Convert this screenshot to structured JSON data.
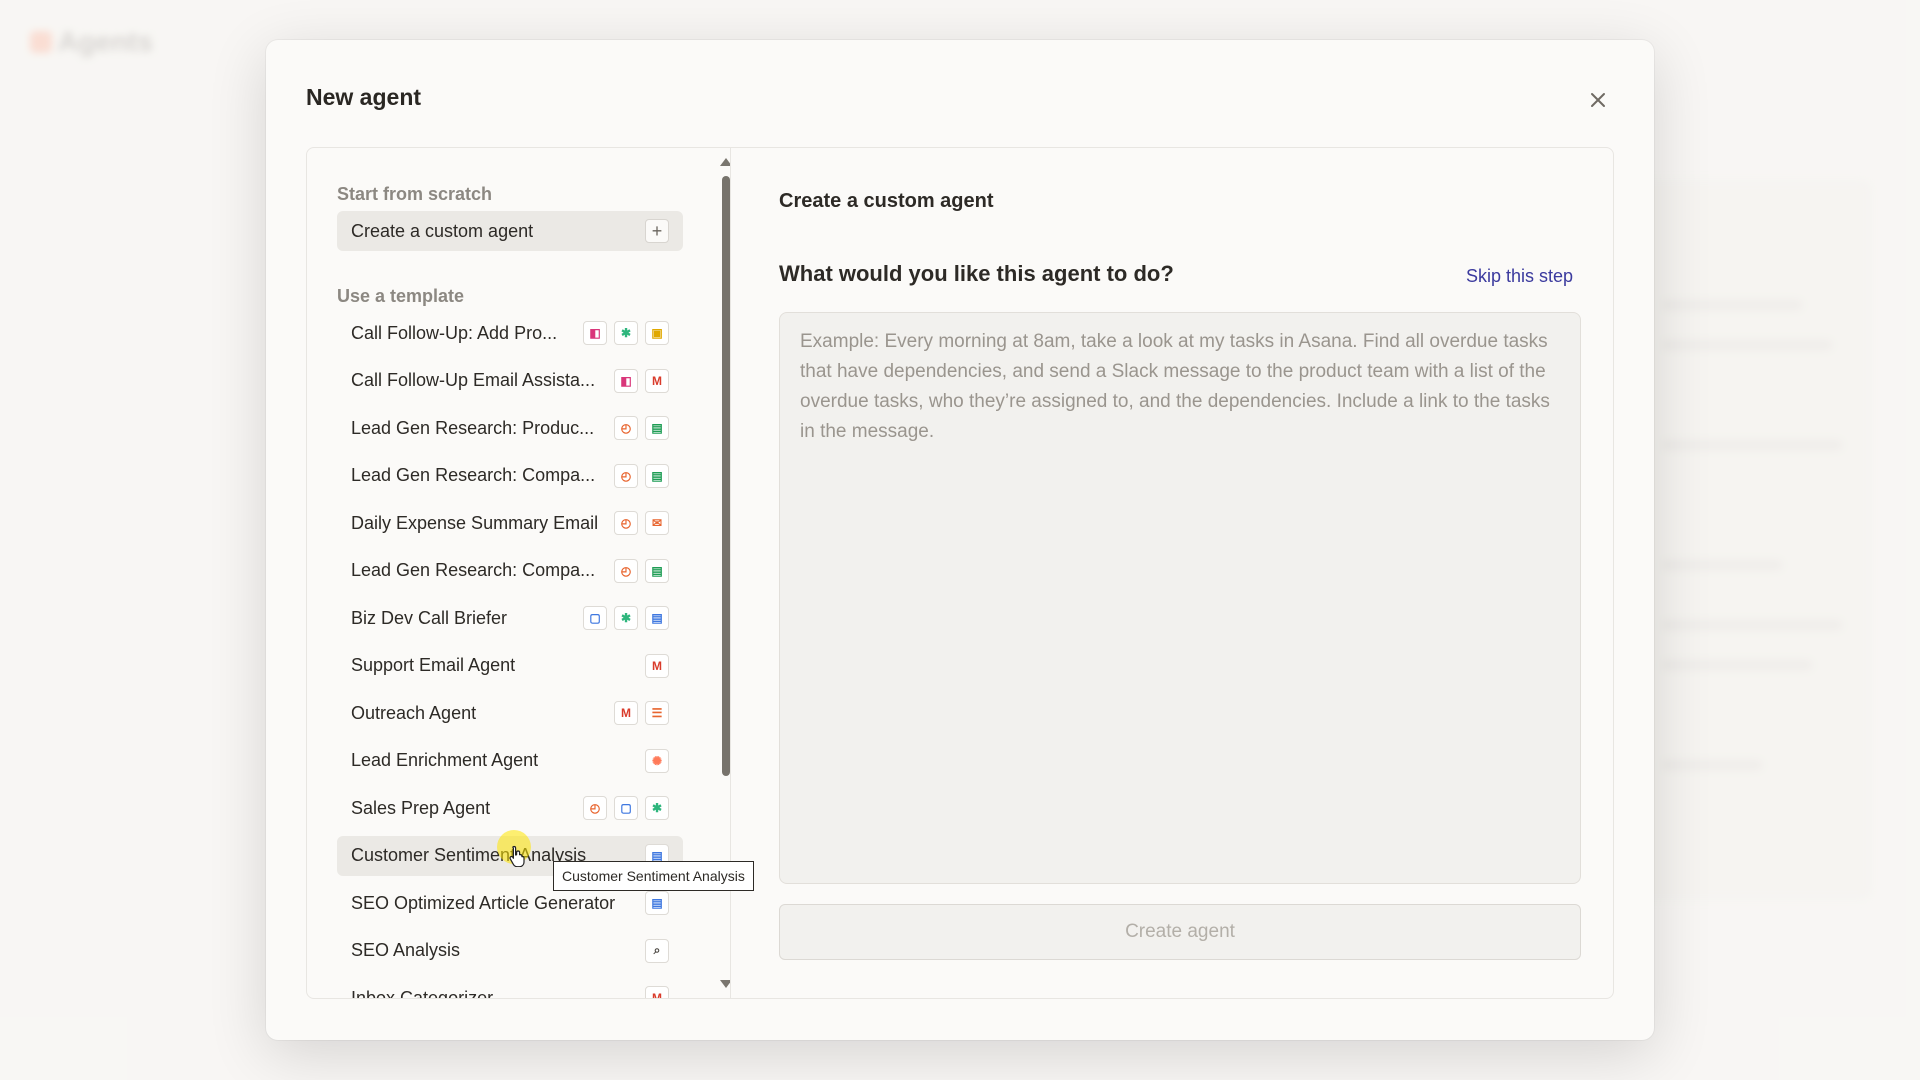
{
  "background": {
    "app_name": "Agents"
  },
  "modal": {
    "title": "New agent",
    "close_label": "×"
  },
  "left": {
    "scratch_section": "Start from scratch",
    "custom_agent_label": "Create a custom agent",
    "template_section": "Use a template",
    "templates": [
      {
        "name": "Call Follow-Up: Add Pro...",
        "icons": [
          "form-icon",
          "slack-icon",
          "sheets-yellow-icon"
        ]
      },
      {
        "name": "Call Follow-Up Email Assista...",
        "icons": [
          "form-icon",
          "gmail-icon"
        ]
      },
      {
        "name": "Lead Gen Research: Produc...",
        "icons": [
          "schedule-icon",
          "google-sheets-icon"
        ]
      },
      {
        "name": "Lead Gen Research: Compa...",
        "icons": [
          "schedule-icon",
          "google-sheets-icon"
        ]
      },
      {
        "name": "Daily Expense Summary Email",
        "icons": [
          "schedule-icon",
          "email-icon"
        ]
      },
      {
        "name": "Lead Gen Research: Compa...",
        "icons": [
          "schedule-icon",
          "google-sheets-icon"
        ]
      },
      {
        "name": "Biz Dev Call Briefer",
        "icons": [
          "google-calendar-icon",
          "slack-icon",
          "google-docs-icon"
        ]
      },
      {
        "name": "Support Email Agent",
        "icons": [
          "gmail-icon"
        ]
      },
      {
        "name": "Outreach Agent",
        "icons": [
          "gmail-icon",
          "formatter-icon"
        ]
      },
      {
        "name": "Lead Enrichment Agent",
        "icons": [
          "hubspot-icon"
        ]
      },
      {
        "name": "Sales Prep Agent",
        "icons": [
          "schedule-icon",
          "google-calendar-icon",
          "slack-icon"
        ]
      },
      {
        "name": "Customer Sentiment Analysis",
        "icons": [
          "google-docs-icon"
        ]
      },
      {
        "name": "SEO Optimized Article Generator",
        "icons": [
          "google-docs-icon"
        ]
      },
      {
        "name": "SEO Analysis",
        "icons": [
          "search-icon"
        ]
      },
      {
        "name": "Inbox Categorizer",
        "icons": [
          "gmail-icon"
        ]
      }
    ],
    "active_index": 11
  },
  "right": {
    "title": "Create a custom agent",
    "question": "What would you like this agent to do?",
    "skip_label": "Skip this step",
    "prompt_placeholder": "Example: Every morning at 8am, take a look at my tasks in Asana. Find all overdue tasks that have dependencies, and send a Slack message to the product team with a list of the overdue tasks, who they’re assigned to, and the dependencies. Include a link to the tasks in the message.",
    "create_button": "Create agent"
  },
  "tooltip": "Customer Sentiment Analysis",
  "colors": {
    "accent_link": "#3b3a9e",
    "orange": "#e8652f",
    "gmail_red": "#d93b2b",
    "docs_blue": "#3f78e0",
    "sheets_green": "#1f9d55"
  }
}
